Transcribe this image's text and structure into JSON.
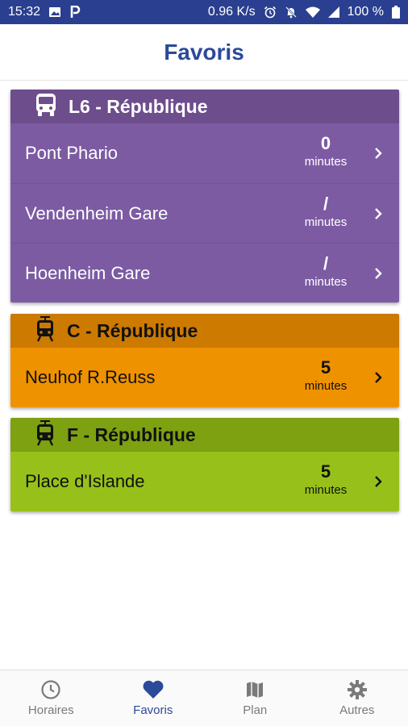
{
  "status_bar": {
    "time": "15:32",
    "network_speed": "0.96 K/s",
    "battery": "100 %",
    "left_icons": [
      "image-icon",
      "parking-icon"
    ],
    "right_icons": [
      "alarm-icon",
      "bell-off-icon",
      "wifi-icon",
      "signal-icon",
      "battery-icon"
    ]
  },
  "header": {
    "title": "Favoris"
  },
  "colors": {
    "status_bar_bg": "#2a3f8f",
    "title": "#2c4a9a",
    "l6_header": "#6e4d8d",
    "l6_body": "#7c5ba3",
    "c_header": "#cc7a00",
    "c_body": "#ef9200",
    "f_header": "#7da110",
    "f_body": "#97c11a",
    "nav_active": "#2c4a9a",
    "nav_inactive": "#7a7a7a"
  },
  "favorites": [
    {
      "icon": "bus-icon",
      "title": "L6 - République",
      "stops": [
        {
          "name": "Pont Phario",
          "time": "0",
          "unit": "minutes"
        },
        {
          "name": "Vendenheim Gare",
          "time": "/",
          "unit": "minutes"
        },
        {
          "name": "Hoenheim Gare",
          "time": "/",
          "unit": "minutes"
        }
      ]
    },
    {
      "icon": "tram-icon",
      "title": "C - République",
      "stops": [
        {
          "name": "Neuhof R.Reuss",
          "time": "5",
          "unit": "minutes"
        }
      ]
    },
    {
      "icon": "tram-icon",
      "title": "F - République",
      "stops": [
        {
          "name": "Place d'Islande",
          "time": "5",
          "unit": "minutes"
        }
      ]
    }
  ],
  "bottom_nav": [
    {
      "label": "Horaires",
      "icon": "clock-icon",
      "active": false
    },
    {
      "label": "Favoris",
      "icon": "heart-icon",
      "active": true
    },
    {
      "label": "Plan",
      "icon": "map-icon",
      "active": false
    },
    {
      "label": "Autres",
      "icon": "gear-icon",
      "active": false
    }
  ]
}
